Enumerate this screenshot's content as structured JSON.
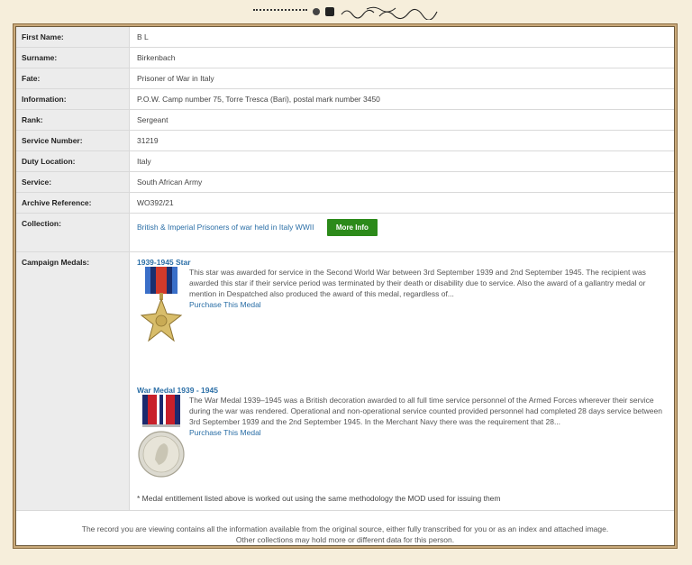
{
  "record": {
    "rows": [
      {
        "label": "First Name:",
        "value": "B L"
      },
      {
        "label": "Surname:",
        "value": "Birkenbach"
      },
      {
        "label": "Fate:",
        "value": "Prisoner of War in Italy"
      },
      {
        "label": "Information:",
        "value": "P.O.W. Camp number 75, Torre Tresca (Bari), postal mark number 3450"
      },
      {
        "label": "Rank:",
        "value": "Sergeant"
      },
      {
        "label": "Service Number:",
        "value": "31219"
      },
      {
        "label": "Duty Location:",
        "value": "Italy"
      },
      {
        "label": "Service:",
        "value": "South African Army"
      },
      {
        "label": "Archive Reference:",
        "value": "WO392/21"
      }
    ],
    "collection": {
      "label": "Collection:",
      "link_text": "British & Imperial Prisoners of war held in Italy WWII",
      "button": "More Info"
    },
    "medals": {
      "label": "Campaign Medals:",
      "items": [
        {
          "title": "1939-1945 Star",
          "description": "This star was awarded for service in the Second World War between 3rd September 1939 and 2nd September 1945. The recipient was awarded this star if their service period was terminated by their death or disability due to service. Also the award of a gallantry medal or mention in Despatched also produced the award of this medal, regardless of...",
          "purchase": "Purchase This Medal"
        },
        {
          "title": "War Medal 1939 - 1945",
          "description": "The War Medal 1939–1945 was a British decoration awarded to all full time service personnel of the Armed Forces wherever their service during the war was rendered. Operational and non-operational service counted provided personnel had completed 28 days service between 3rd September 1939 and the 2nd September 1945. In the Merchant Navy there was the requirement that 28...",
          "purchase": "Purchase This Medal"
        }
      ],
      "note": "* Medal entitlement listed above is worked out using the same methodology the MOD used for issuing them"
    }
  },
  "footer": {
    "line1": "The record you are viewing contains all the information available from the original source, either fully transcribed for you or as an index and attached image.",
    "line2": "Other collections may hold more or different data for this person."
  },
  "colors": {
    "accent_link": "#2a6ea6",
    "button_green": "#2c8a1a",
    "frame": "#c9a97a"
  }
}
